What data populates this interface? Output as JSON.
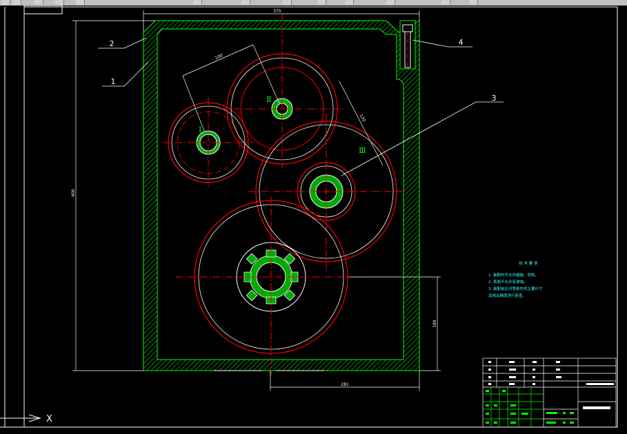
{
  "toolbar": {
    "status_text": ""
  },
  "drawing": {
    "dimensions": {
      "overall_width": "375",
      "overall_height": "400",
      "center_distance_1": "100",
      "center_distance_2": "120",
      "lower_horizontal": "281",
      "lower_vertical": "189"
    },
    "callouts": [
      "1",
      "2",
      "3",
      "4"
    ],
    "shaft_labels": [
      "Ⅰ",
      "Ⅱ",
      "Ⅲ"
    ],
    "technical_requirements": {
      "title": "技 术 要 求",
      "lines": [
        "1. 装配时不允许磕碰、划伤。",
        "2. 表面不允许有锈蚀。",
        "3. 装配前应对零部件的主要尺寸",
        "及相关精度进行复查。"
      ]
    },
    "ucs_axis": "X",
    "colors": {
      "housing": "#00ff00",
      "gear_outline": "#ff0000",
      "centerline": "#ff0000",
      "dimension": "#ffffff",
      "notes": "#33ffff"
    }
  }
}
